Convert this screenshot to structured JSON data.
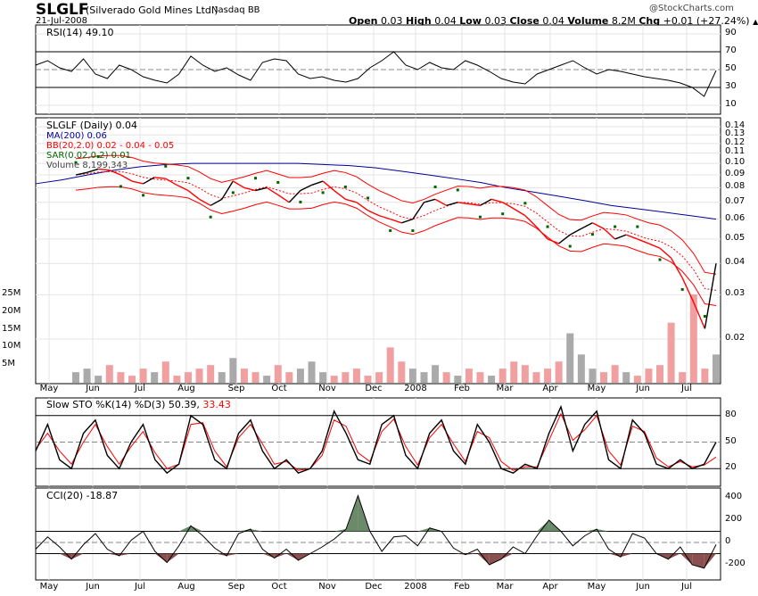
{
  "header": {
    "symbol": "SLGLF",
    "name": "(Silverado Gold Mines Ltd.)",
    "exchange": "Nasdaq BB",
    "date": "21-Jul-2008",
    "credit": "@StockCharts.com",
    "quote": {
      "open_l": "Open",
      "open": "0.03",
      "high_l": "High",
      "high": "0.04",
      "low_l": "Low",
      "low": "0.03",
      "close_l": "Close",
      "close": "0.04",
      "vol_l": "Volume",
      "vol": "8.2M",
      "chg_l": "Chg",
      "chg": "+0.01 (+27.24%)"
    }
  },
  "colors": {
    "price": "#000000",
    "down": "#ff0000",
    "ma": "#000099",
    "bb": "#ff0000",
    "sar": "#006600",
    "vol_up": "#aaaaaa",
    "vol_down": "#f0a0a0",
    "cci_fill": "#8a5050",
    "cci_fill_pos": "#6a8a6a"
  },
  "chart_data": [
    {
      "type": "line",
      "title": "RSI(14) 49.10",
      "yticks": [
        90,
        70,
        50,
        30,
        10
      ],
      "ylim": [
        0,
        100
      ],
      "values": [
        55,
        60,
        52,
        48,
        62,
        45,
        40,
        55,
        50,
        42,
        38,
        35,
        45,
        65,
        55,
        48,
        52,
        44,
        38,
        58,
        62,
        60,
        45,
        40,
        42,
        38,
        36,
        40,
        52,
        60,
        70,
        55,
        50,
        58,
        52,
        50,
        60,
        55,
        48,
        40,
        36,
        34,
        45,
        50,
        55,
        60,
        52,
        45,
        50,
        48,
        45,
        42,
        40,
        38,
        35,
        30,
        20,
        49
      ]
    },
    {
      "type": "line",
      "title": "SLGLF (Daily) 0.04",
      "legend": [
        "MA(200) 0.06",
        "BB(20,2.0) 0.02 - 0.04 - 0.05",
        "SAR(0.02,0.2) 0.01",
        "Volume 8,199,343"
      ],
      "yticks": [
        "0.14",
        "0.13",
        "0.12",
        "0.11",
        "0.10",
        "0.09",
        "0.08",
        "0.07",
        "0.06",
        "0.05",
        "0.04",
        "0.03",
        "0.02"
      ],
      "ylim": [
        0.017,
        0.14
      ],
      "scale": "log",
      "price": [
        0.09,
        0.092,
        0.095,
        0.094,
        0.09,
        0.085,
        0.083,
        0.088,
        0.087,
        0.082,
        0.078,
        0.072,
        0.068,
        0.072,
        0.085,
        0.08,
        0.078,
        0.08,
        0.075,
        0.07,
        0.078,
        0.082,
        0.085,
        0.078,
        0.072,
        0.07,
        0.065,
        0.062,
        0.06,
        0.058,
        0.06,
        0.07,
        0.072,
        0.068,
        0.07,
        0.069,
        0.068,
        0.072,
        0.07,
        0.066,
        0.062,
        0.056,
        0.05,
        0.048,
        0.052,
        0.055,
        0.058,
        0.055,
        0.05,
        0.052,
        0.05,
        0.048,
        0.046,
        0.042,
        0.035,
        0.028,
        0.022,
        0.04
      ],
      "ma200": [
        0.083,
        0.086,
        0.09,
        0.094,
        0.097,
        0.099,
        0.1,
        0.1,
        0.1,
        0.1,
        0.1,
        0.099,
        0.098,
        0.096,
        0.093,
        0.09,
        0.087,
        0.084,
        0.08,
        0.077,
        0.074,
        0.071,
        0.068,
        0.066,
        0.064,
        0.062,
        0.06
      ],
      "volume_yticks": [
        "25M",
        "20M",
        "15M",
        "10M",
        "5M"
      ],
      "volume": [
        3,
        4,
        2,
        5,
        3,
        2,
        4,
        3,
        6,
        2,
        3,
        4,
        5,
        3,
        7,
        4,
        3,
        2,
        5,
        3,
        4,
        6,
        3,
        2,
        3,
        4,
        2,
        3,
        10,
        6,
        4,
        3,
        5,
        3,
        2,
        4,
        3,
        2,
        4,
        6,
        5,
        3,
        4,
        6,
        14,
        8,
        4,
        3,
        5,
        3,
        2,
        4,
        5,
        17,
        3,
        25,
        4,
        8
      ]
    },
    {
      "type": "line",
      "title": "Slow STO %K(14) %D(3) 50.39,",
      "title2": "33.43",
      "yticks": [
        80,
        50,
        20
      ],
      "ylim": [
        0,
        100
      ],
      "k": [
        40,
        70,
        30,
        20,
        60,
        75,
        35,
        20,
        50,
        70,
        30,
        15,
        25,
        80,
        70,
        30,
        20,
        60,
        75,
        40,
        20,
        30,
        15,
        20,
        40,
        85,
        60,
        30,
        25,
        70,
        80,
        35,
        20,
        60,
        75,
        40,
        25,
        70,
        50,
        20,
        15,
        25,
        20,
        60,
        90,
        40,
        70,
        85,
        30,
        20,
        75,
        60,
        25,
        20,
        30,
        20,
        25,
        50
      ],
      "d": [
        42,
        60,
        40,
        25,
        50,
        70,
        45,
        25,
        45,
        62,
        38,
        20,
        25,
        70,
        72,
        40,
        22,
        55,
        70,
        48,
        25,
        28,
        18,
        20,
        35,
        75,
        68,
        38,
        28,
        62,
        76,
        45,
        24,
        55,
        70,
        48,
        28,
        62,
        55,
        28,
        18,
        22,
        22,
        52,
        82,
        52,
        64,
        80,
        40,
        24,
        68,
        62,
        32,
        22,
        28,
        22,
        24,
        33
      ]
    },
    {
      "type": "area",
      "title": "CCI(20) -18.87",
      "yticks": [
        400,
        200,
        0,
        -200
      ],
      "ylim": [
        -320,
        480
      ],
      "values": [
        -60,
        50,
        -40,
        -150,
        -20,
        80,
        -60,
        -120,
        20,
        100,
        -80,
        -180,
        -30,
        150,
        60,
        -50,
        -120,
        80,
        120,
        -60,
        -140,
        -60,
        -160,
        -100,
        -40,
        30,
        120,
        420,
        100,
        -80,
        50,
        60,
        -30,
        130,
        100,
        -50,
        -110,
        -60,
        -200,
        -150,
        -40,
        -100,
        60,
        200,
        100,
        -30,
        60,
        120,
        -60,
        -130,
        80,
        40,
        -100,
        -150,
        -40,
        -200,
        -230,
        -19
      ]
    }
  ],
  "xaxis": {
    "labels": [
      "May",
      "Jun",
      "Jul",
      "Aug",
      "Sep",
      "Oct",
      "Nov",
      "Dec",
      "2008",
      "Feb",
      "Mar",
      "Apr",
      "May",
      "Jun",
      "Jul"
    ]
  }
}
